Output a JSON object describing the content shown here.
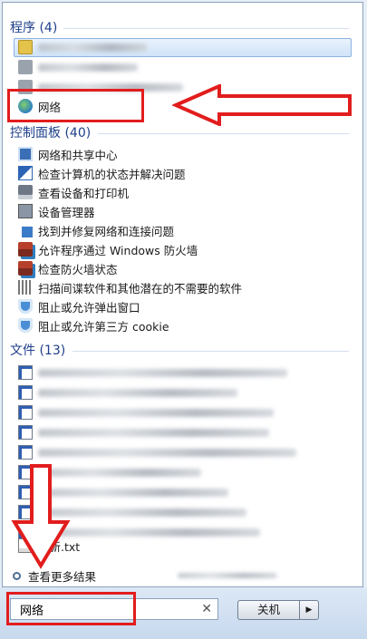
{
  "programs": {
    "header": "程序 (4)",
    "items": [
      {
        "label": "",
        "icon": "folder-icon"
      },
      {
        "label": "",
        "icon": "program-icon"
      },
      {
        "label": "",
        "icon": "program-icon"
      },
      {
        "label": "网络",
        "icon": "network-icon"
      }
    ]
  },
  "control_panel": {
    "header": "控制面板 (40)",
    "items": [
      {
        "label": "网络和共享中心",
        "icon": "network-center-icon"
      },
      {
        "label": "检查计算机的状态并解决问题",
        "icon": "action-center-flag-icon"
      },
      {
        "label": "查看设备和打印机",
        "icon": "printer-icon"
      },
      {
        "label": "设备管理器",
        "icon": "device-manager-icon"
      },
      {
        "label": "找到并修复网络和连接问题",
        "icon": "troubleshoot-icon"
      },
      {
        "label": "允许程序通过 Windows 防火墙",
        "icon": "firewall-icon"
      },
      {
        "label": "检查防火墙状态",
        "icon": "firewall-icon"
      },
      {
        "label": "扫描间谍软件和其他潜在的不需要的软件",
        "icon": "scan-icon"
      },
      {
        "label": "阻止或允许弹出窗口",
        "icon": "shield-icon"
      },
      {
        "label": "阻止或允许第三方 cookie",
        "icon": "shield-icon"
      }
    ]
  },
  "files": {
    "header": "文件 (13)",
    "last_item": "更新.txt"
  },
  "see_more": "查看更多结果",
  "search": {
    "value": "网络"
  },
  "shutdown_label": "关机",
  "colors": {
    "header": "#1e3f8b",
    "annotation": "#e21d1d",
    "selection": "#cfe3f8"
  }
}
